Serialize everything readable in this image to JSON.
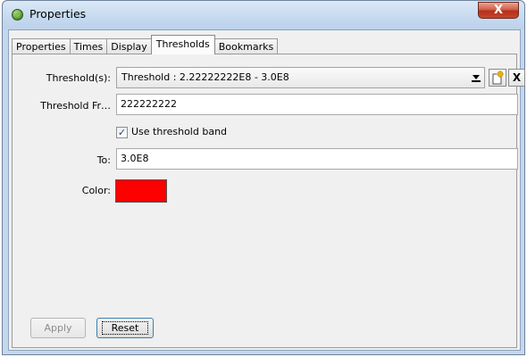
{
  "window": {
    "title": "Properties",
    "close_label": "X"
  },
  "tabs": [
    {
      "label": "Properties"
    },
    {
      "label": "Times"
    },
    {
      "label": "Display"
    },
    {
      "label": "Thresholds",
      "active": true
    },
    {
      "label": "Bookmarks"
    }
  ],
  "form": {
    "thresholds_label": "Threshold(s):",
    "thresholds_value": "Threshold : 2.22222222E8 - 3.0E8",
    "new_threshold_icon": "new-document-icon",
    "delete_threshold_label": "X",
    "threshold_from_label": "Threshold Fr…",
    "threshold_from_value": "222222222",
    "use_band_label": "Use threshold band",
    "use_band_checked": true,
    "to_label": "To:",
    "to_value": "3.0E8",
    "color_label": "Color:",
    "color_value": "#ff0000"
  },
  "buttons": {
    "apply_label": "Apply",
    "apply_enabled": false,
    "reset_label": "Reset"
  }
}
